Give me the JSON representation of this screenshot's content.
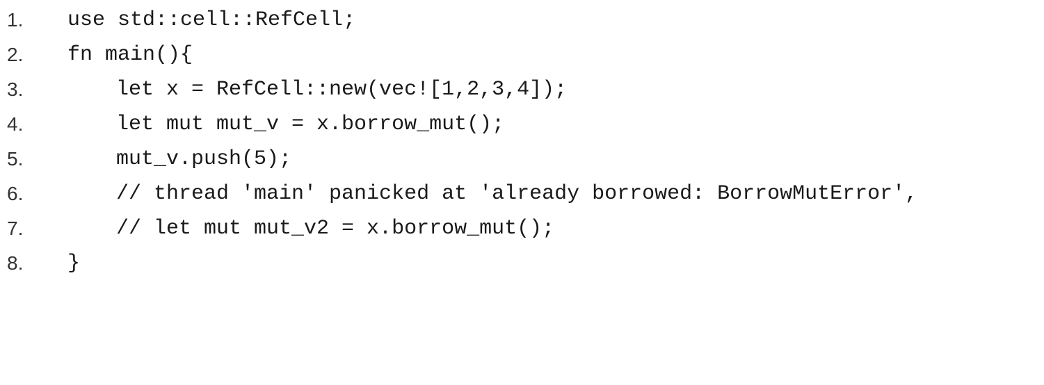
{
  "code": {
    "lines": [
      {
        "number": "1.",
        "text": "use std::cell::RefCell;"
      },
      {
        "number": "2.",
        "text": "fn main(){"
      },
      {
        "number": "3.",
        "text": "let x = RefCell::new(vec![1,2,3,4]);"
      },
      {
        "number": "4.",
        "text": "let mut mut_v = x.borrow_mut();"
      },
      {
        "number": "5.",
        "text": "mut_v.push(5);"
      },
      {
        "number": "6.",
        "text": "// thread 'main' panicked at 'already borrowed: BorrowMutError',"
      },
      {
        "number": "7.",
        "text": "// let mut mut_v2 = x.borrow_mut();"
      },
      {
        "number": "8.",
        "text": "}"
      }
    ]
  }
}
